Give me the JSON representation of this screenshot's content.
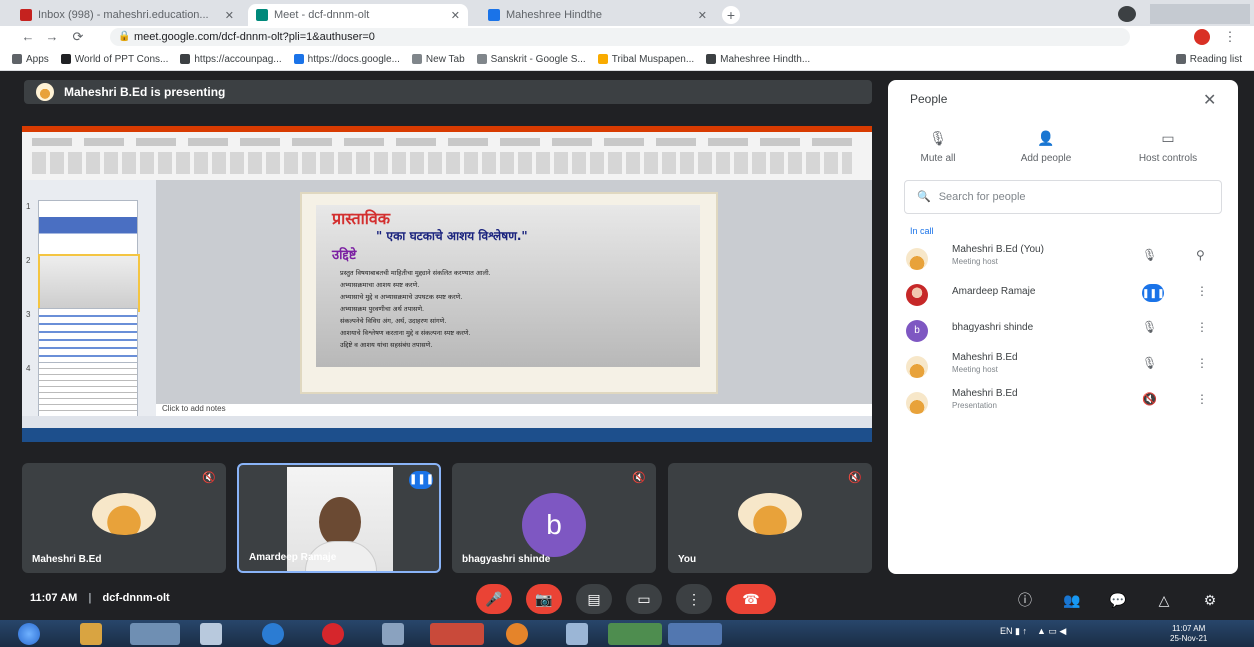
{
  "browser": {
    "tabs": [
      {
        "title": "Inbox (998) - maheshri.education..."
      },
      {
        "title": "Meet - dcf-dnnm-olt"
      },
      {
        "title": "Maheshree Hindthe"
      }
    ],
    "url": "meet.google.com/dcf-dnnm-olt?pli=1&authuser=0",
    "bookmarks": [
      "Apps",
      "World of PPT Cons...",
      "https://accounpag...",
      "https://docs.google...",
      "New Tab",
      "Sanskrit - Google S...",
      "Tribal Muspapen...",
      "Maheshree Hindth..."
    ],
    "reading_list": "Reading list"
  },
  "meet": {
    "presenting_banner": "Maheshri B.Ed is presenting",
    "slide": {
      "heading": "प्रास्ताविक",
      "subheading": "\" एका घटकाचे आशय विश्लेषण.\"",
      "heading2": "उद्दिष्टे",
      "points": [
        "प्रस्तुत विषयाबाबतची माहितीचा मुद्द्याने संकलित करण्यात आली.",
        "अभ्यासक्रमाचा आशय स्पष्ट करणे.",
        "अभ्यासाचे मुद्दे व अभ्यासक्रमाचे उपघटक स्पष्ट करणे.",
        "अभ्यासक्रम पुरवणीचा अर्थ तपासणे.",
        "संकल्पनेचे विविध अंग, अर्थ, उदाहरण सांगणे.",
        "आशयाचे विश्लेषण करताना मुद्दे व संकल्पना स्पष्ट करणे.",
        "उद्दिष्टे व आशय यांचा सहसंबंध तपासणे."
      ],
      "notes_placeholder": "Click to add notes"
    },
    "tiles": [
      {
        "name": "Maheshri B.Ed"
      },
      {
        "name": "Amardeep Ramaje"
      },
      {
        "name": "bhagyashri shinde",
        "initial": "b"
      },
      {
        "name": "You"
      }
    ],
    "time": "11:07 AM",
    "meeting_code": "dcf-dnnm-olt"
  },
  "people_panel": {
    "title": "People",
    "actions": [
      "Mute all",
      "Add people",
      "Host controls"
    ],
    "search_placeholder": "Search for people",
    "section_label": "In call",
    "participants": [
      {
        "name": "Maheshri B.Ed (You)",
        "sub": "Meeting host"
      },
      {
        "name": "Amardeep Ramaje",
        "sub": ""
      },
      {
        "name": "bhagyashri shinde",
        "sub": ""
      },
      {
        "name": "Maheshri B.Ed",
        "sub": "Meeting host"
      },
      {
        "name": "Maheshri B.Ed",
        "sub": "Presentation"
      }
    ]
  },
  "taskbar": {
    "clock_time": "11:07 AM",
    "clock_date": "25-Nov-21"
  },
  "colors": {
    "accent_red": "#ea4335",
    "accent_blue": "#1a73e8",
    "meet_bg": "#202124"
  }
}
